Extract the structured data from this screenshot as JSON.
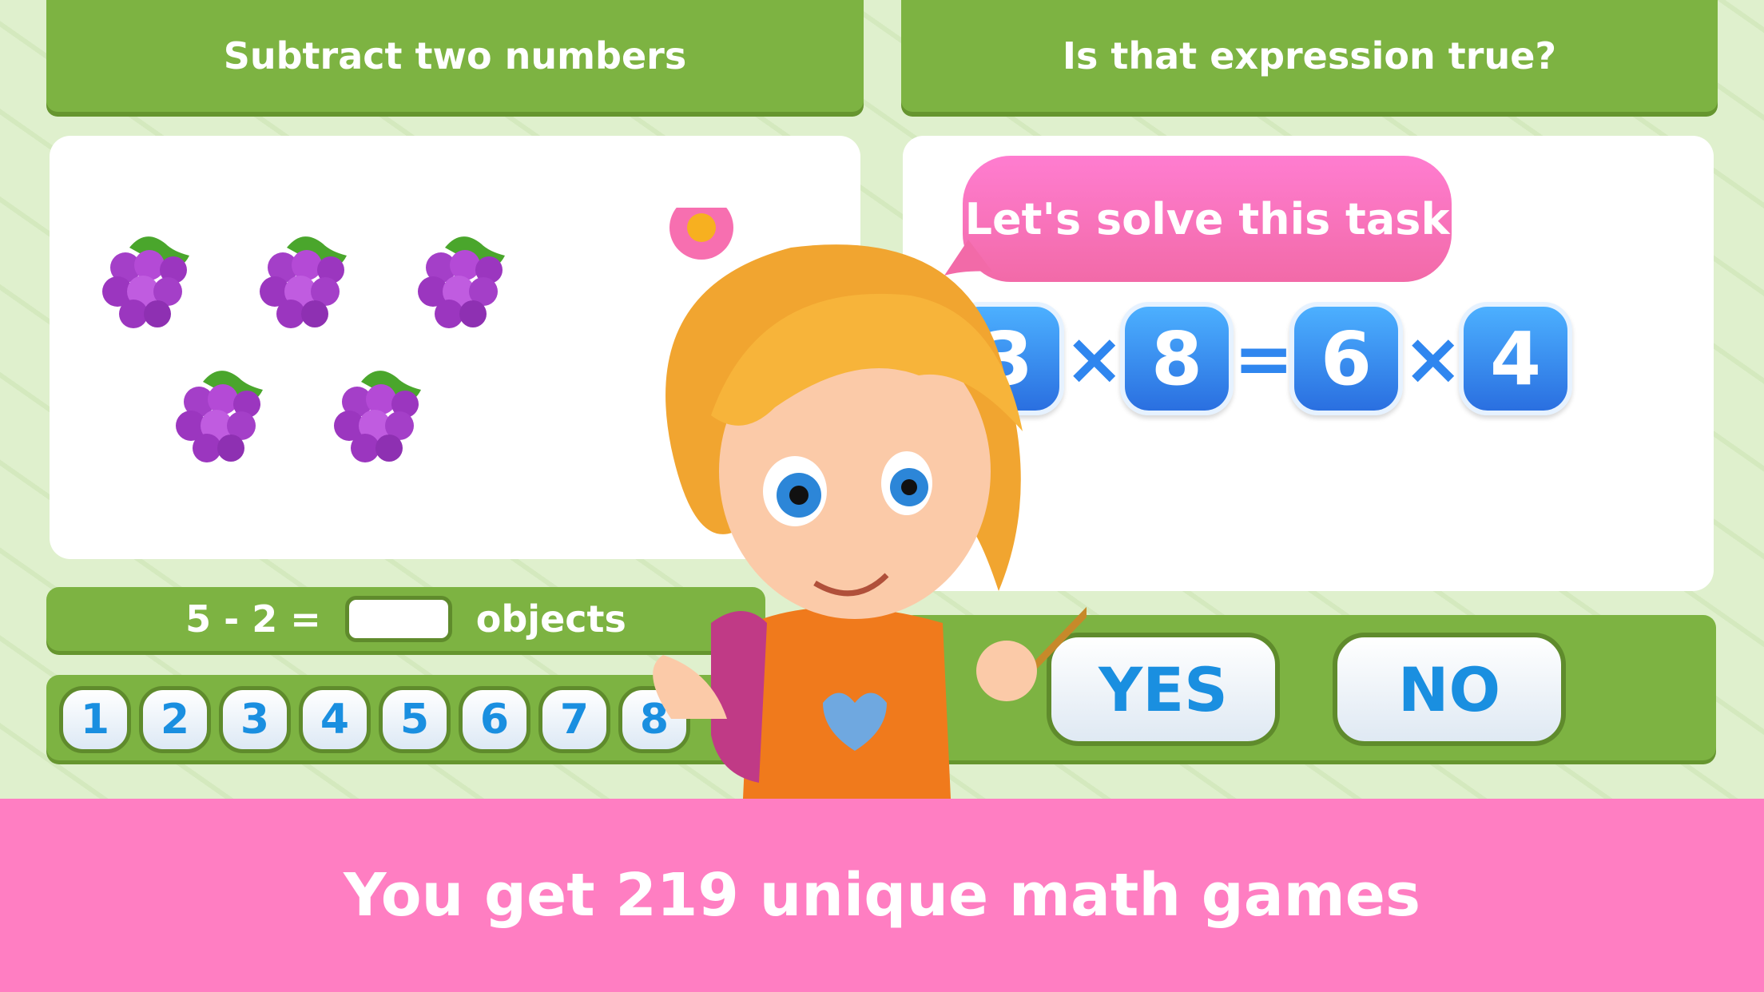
{
  "left_game": {
    "title": "Subtract two numbers",
    "equation": "5 - 2 =",
    "unit": "objects",
    "answer_value": "",
    "number_keys": [
      "1",
      "2",
      "3",
      "4",
      "5",
      "6",
      "7",
      "8"
    ],
    "grape_count": 5
  },
  "right_game": {
    "title": "Is that expression true?",
    "speech": "Let's solve this task",
    "expression": [
      "3",
      "×",
      "8",
      "=",
      "6",
      "×",
      "4"
    ],
    "yes_label": "YES",
    "no_label": "NO"
  },
  "footer": {
    "text": "You get 219 unique math games"
  },
  "colors": {
    "green": "#7db342",
    "pink": "#ff7ec2",
    "blue": "#2a6fe0",
    "key_text": "#1a8fe0"
  }
}
